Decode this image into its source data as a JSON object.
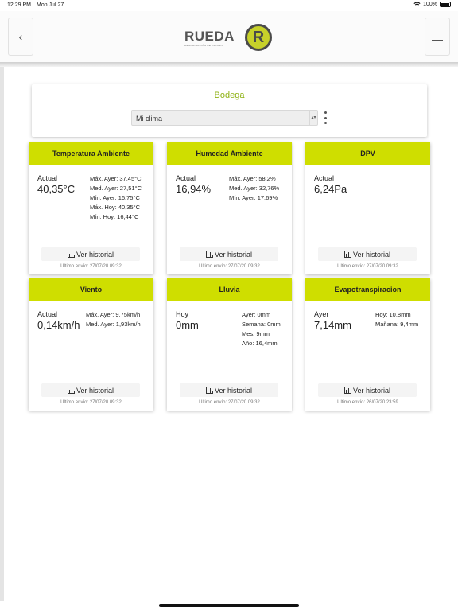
{
  "status": {
    "time": "12:29 PM",
    "date": "Mon Jul 27",
    "battery": "100%"
  },
  "header": {
    "brand": "RUEDA",
    "brand_sub": "DENOMINACIÓN DE ORIGEN",
    "logo_letter": "R"
  },
  "bodega": {
    "title": "Bodega",
    "selected": "Mi clima"
  },
  "history_label": "Ver historial",
  "colors": {
    "accent": "#cfde00",
    "title_green": "#8fb215"
  },
  "cards": [
    {
      "title": "Temperatura Ambiente",
      "main_label": "Actual",
      "main_value": "40,35°C",
      "stats": [
        "Máx. Ayer: 37,45°C",
        "Med. Ayer: 27,51°C",
        "Mín. Ayer: 16,75°C",
        "Máx. Hoy: 40,35°C",
        "Mín. Hoy: 16,44°C"
      ],
      "footer": "Último envío: 27/07/20 09:32"
    },
    {
      "title": "Humedad Ambiente",
      "main_label": "Actual",
      "main_value": "16,94%",
      "stats": [
        "Máx. Ayer: 58,2%",
        "Med. Ayer: 32,76%",
        "Mín. Ayer: 17,69%"
      ],
      "footer": "Último envío: 27/07/20 09:32"
    },
    {
      "title": "DPV",
      "main_label": "Actual",
      "main_value": "6,24Pa",
      "stats": [],
      "footer": "Último envío: 27/07/20 09:32"
    },
    {
      "title": "Viento",
      "main_label": "Actual",
      "main_value": "0,14km/h",
      "stats": [
        "Máx. Ayer: 9,75km/h",
        "Med. Ayer: 1,93km/h"
      ],
      "footer": "Último envío: 27/07/20 09:32"
    },
    {
      "title": "Lluvia",
      "main_label": "Hoy",
      "main_value": "0mm",
      "stats": [
        "Ayer: 0mm",
        "Semana: 0mm",
        "Mes: 9mm",
        "Año: 16,4mm"
      ],
      "footer": "Último envío: 27/07/20 09:32"
    },
    {
      "title": "Evapotranspiracion",
      "main_label": "Ayer",
      "main_value": "7,14mm",
      "stats": [
        "Hoy: 10,8mm",
        "Mañana: 9,4mm"
      ],
      "footer": "Último envío: 26/07/20 23:59"
    }
  ]
}
